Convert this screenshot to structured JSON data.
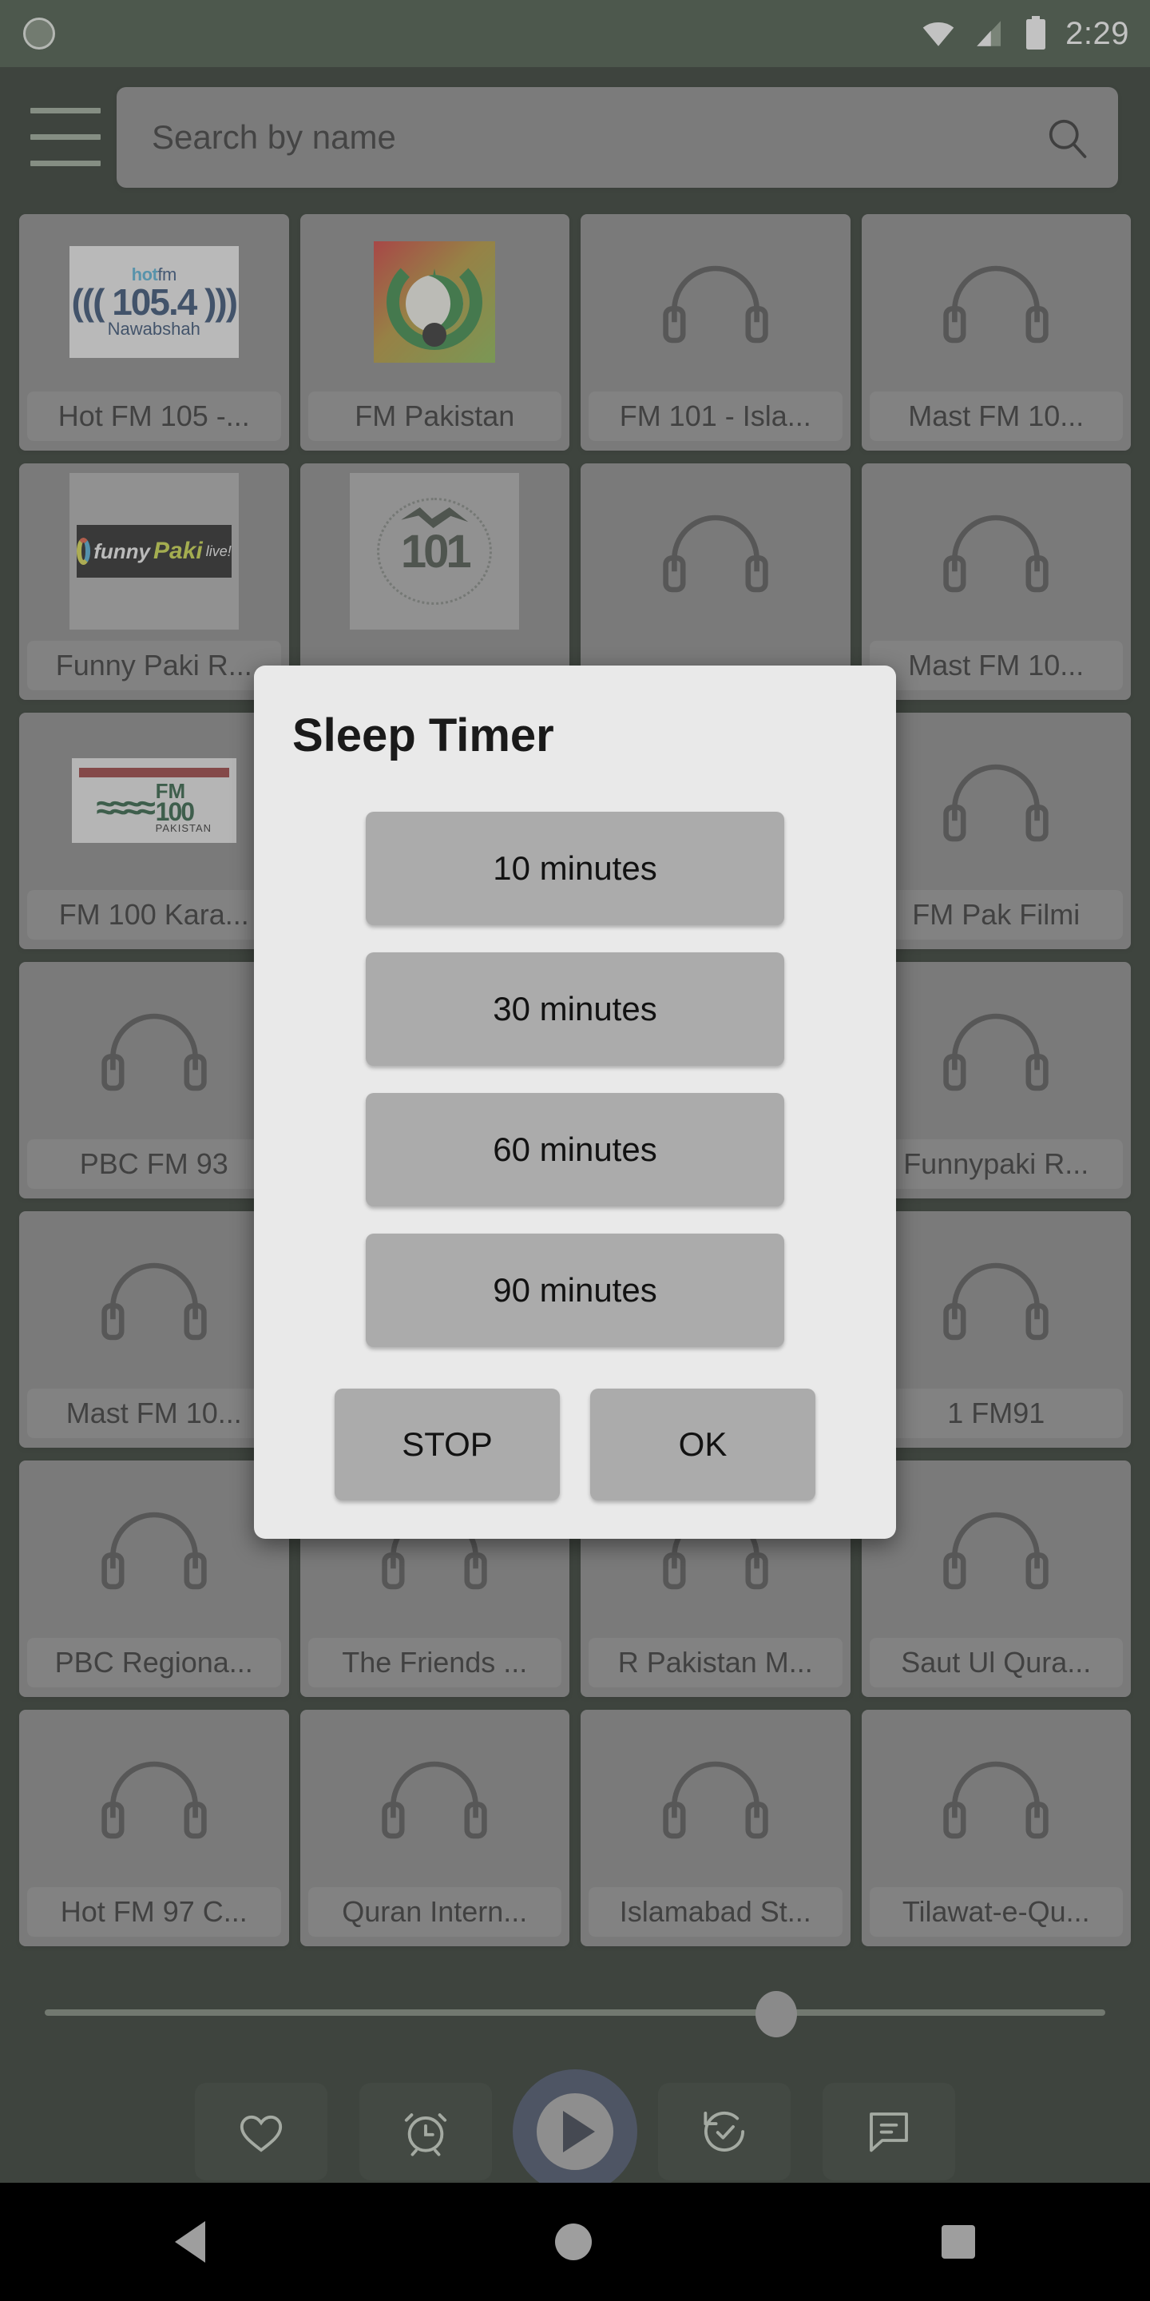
{
  "statusbar": {
    "time": "2:29",
    "icons": [
      "sun-icon",
      "wifi-icon",
      "cellular-signal-icon",
      "battery-icon"
    ]
  },
  "topbar": {
    "menu_icon": "hamburger-menu-icon",
    "search": {
      "placeholder": "Search by name",
      "value": "",
      "icon": "search-icon"
    }
  },
  "stations": [
    {
      "name": "Hot FM 105 -...",
      "logo": "hotfm"
    },
    {
      "name": "FM Pakistan",
      "logo": "fmpakistan"
    },
    {
      "name": "FM 101 - Isla...",
      "logo": "headphones"
    },
    {
      "name": "Mast FM 10...",
      "logo": "headphones"
    },
    {
      "name": "Funny Paki R...",
      "logo": "funnypaki"
    },
    {
      "name": "",
      "logo": "fm101tune"
    },
    {
      "name": "",
      "logo": "headphones"
    },
    {
      "name": "Mast FM 10...",
      "logo": "headphones"
    },
    {
      "name": "FM 100 Kara...",
      "logo": "fm100"
    },
    {
      "name": "",
      "logo": "headphones"
    },
    {
      "name": "",
      "logo": "headphones"
    },
    {
      "name": "FM Pak Filmi",
      "logo": "headphones"
    },
    {
      "name": "PBC FM 93",
      "logo": "headphones"
    },
    {
      "name": "",
      "logo": "headphones"
    },
    {
      "name": "",
      "logo": "headphones"
    },
    {
      "name": "Funnypaki R...",
      "logo": "headphones"
    },
    {
      "name": "Mast FM 10...",
      "logo": "headphones"
    },
    {
      "name": "",
      "logo": "headphones"
    },
    {
      "name": "",
      "logo": "headphones"
    },
    {
      "name": "1 FM91",
      "logo": "headphones"
    },
    {
      "name": "PBC Regiona...",
      "logo": "headphones"
    },
    {
      "name": "The Friends ...",
      "logo": "headphones"
    },
    {
      "name": "R Pakistan M...",
      "logo": "headphones"
    },
    {
      "name": "Saut Ul Qura...",
      "logo": "headphones"
    },
    {
      "name": "Hot FM 97 C...",
      "logo": "headphones"
    },
    {
      "name": "Quran Intern...",
      "logo": "headphones"
    },
    {
      "name": "Islamabad St...",
      "logo": "headphones"
    },
    {
      "name": "Tilawat-e-Qu...",
      "logo": "headphones"
    }
  ],
  "player": {
    "volume_percent": 69,
    "controls": [
      {
        "icon": "heart-icon",
        "name": "favorite-button"
      },
      {
        "icon": "alarm-clock-icon",
        "name": "sleep-timer-button"
      },
      {
        "icon": "play-icon",
        "name": "play-button"
      },
      {
        "icon": "history-icon",
        "name": "recently-played-button"
      },
      {
        "icon": "chat-icon",
        "name": "chat-button"
      }
    ]
  },
  "dialog": {
    "title": "Sleep Timer",
    "options": [
      "10 minutes",
      "30 minutes",
      "60 minutes",
      "90 minutes"
    ],
    "actions": [
      {
        "label": "STOP",
        "name": "stop-button"
      },
      {
        "label": "OK",
        "name": "ok-button"
      }
    ]
  },
  "navbar": {
    "back": "back-nav-icon",
    "home": "home-nav-icon",
    "recents": "recents-nav-icon"
  },
  "colors": {
    "status_bar": "#2b3e2a",
    "app_background": "#0f1a0f",
    "card": "#7c7c7c",
    "dialog_background": "#e9e9e9",
    "dialog_button": "#ababab",
    "play_button": "#2c3a54"
  }
}
